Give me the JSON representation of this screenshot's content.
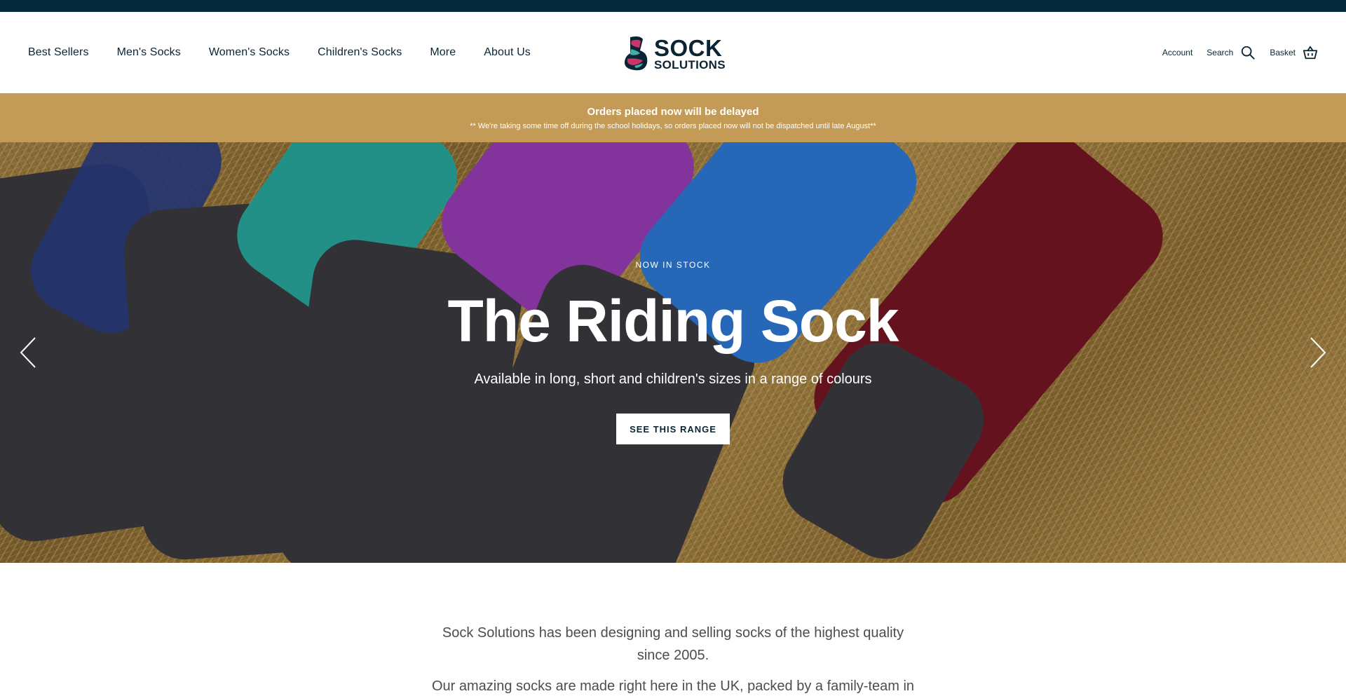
{
  "nav": {
    "items": [
      {
        "label": "Best Sellers"
      },
      {
        "label": "Men's Socks"
      },
      {
        "label": "Women's Socks"
      },
      {
        "label": "Children's Socks"
      },
      {
        "label": "More"
      },
      {
        "label": "About Us"
      }
    ]
  },
  "logo": {
    "line1": "SOCK",
    "line2": "SOLUTIONS"
  },
  "utility": {
    "account": "Account",
    "search": "Search",
    "basket": "Basket"
  },
  "notice": {
    "title": "Orders placed now will be delayed",
    "message": "** We're taking some time off during the school holidays, so orders placed now will not be dispatched until late August**"
  },
  "hero": {
    "kicker": "NOW IN STOCK",
    "title": "The Riding Sock",
    "subtitle": "Available in long, short and children's sizes in a range of colours",
    "button": "SEE THIS RANGE"
  },
  "intro": {
    "p1": "Sock Solutions has been designing and selling socks of the highest quality since 2005.",
    "p2": "Our amazing socks are made right here in the UK, packed by a family-team in"
  },
  "colors": {
    "topbar": "#052a3b",
    "notice_bg": "#c49b56",
    "text_dark": "#0b2433"
  }
}
